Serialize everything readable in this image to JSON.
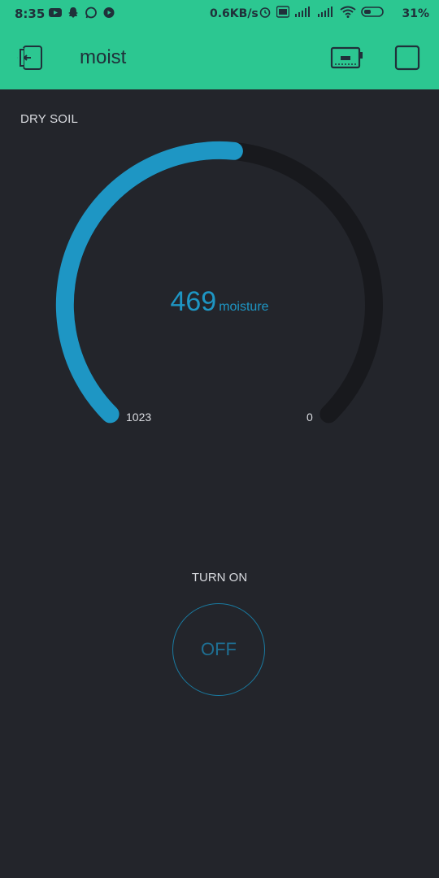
{
  "status_bar": {
    "time": "8:35",
    "network_speed": "0.6KB/s",
    "battery_percent": "31%",
    "left_icons": [
      "youtube-icon",
      "snapchat-icon",
      "whatsapp-icon",
      "media-icon"
    ],
    "right_icons": [
      "alarm-icon",
      "volte-icon",
      "signal-4g-icon",
      "signal-icon",
      "wifi-icon",
      "battery-icon"
    ]
  },
  "app_bar": {
    "title": "moist",
    "color": "#2cc791"
  },
  "gauge": {
    "label": "DRY SOIL",
    "value": "469",
    "unit": "moisture",
    "min_label": "1023",
    "max_label": "0",
    "fill_fraction": 0.52,
    "accent": "#1e96c4",
    "track": "#18191d"
  },
  "button": {
    "label": "TURN ON",
    "state_text": "OFF",
    "accent": "#1e6f93"
  }
}
